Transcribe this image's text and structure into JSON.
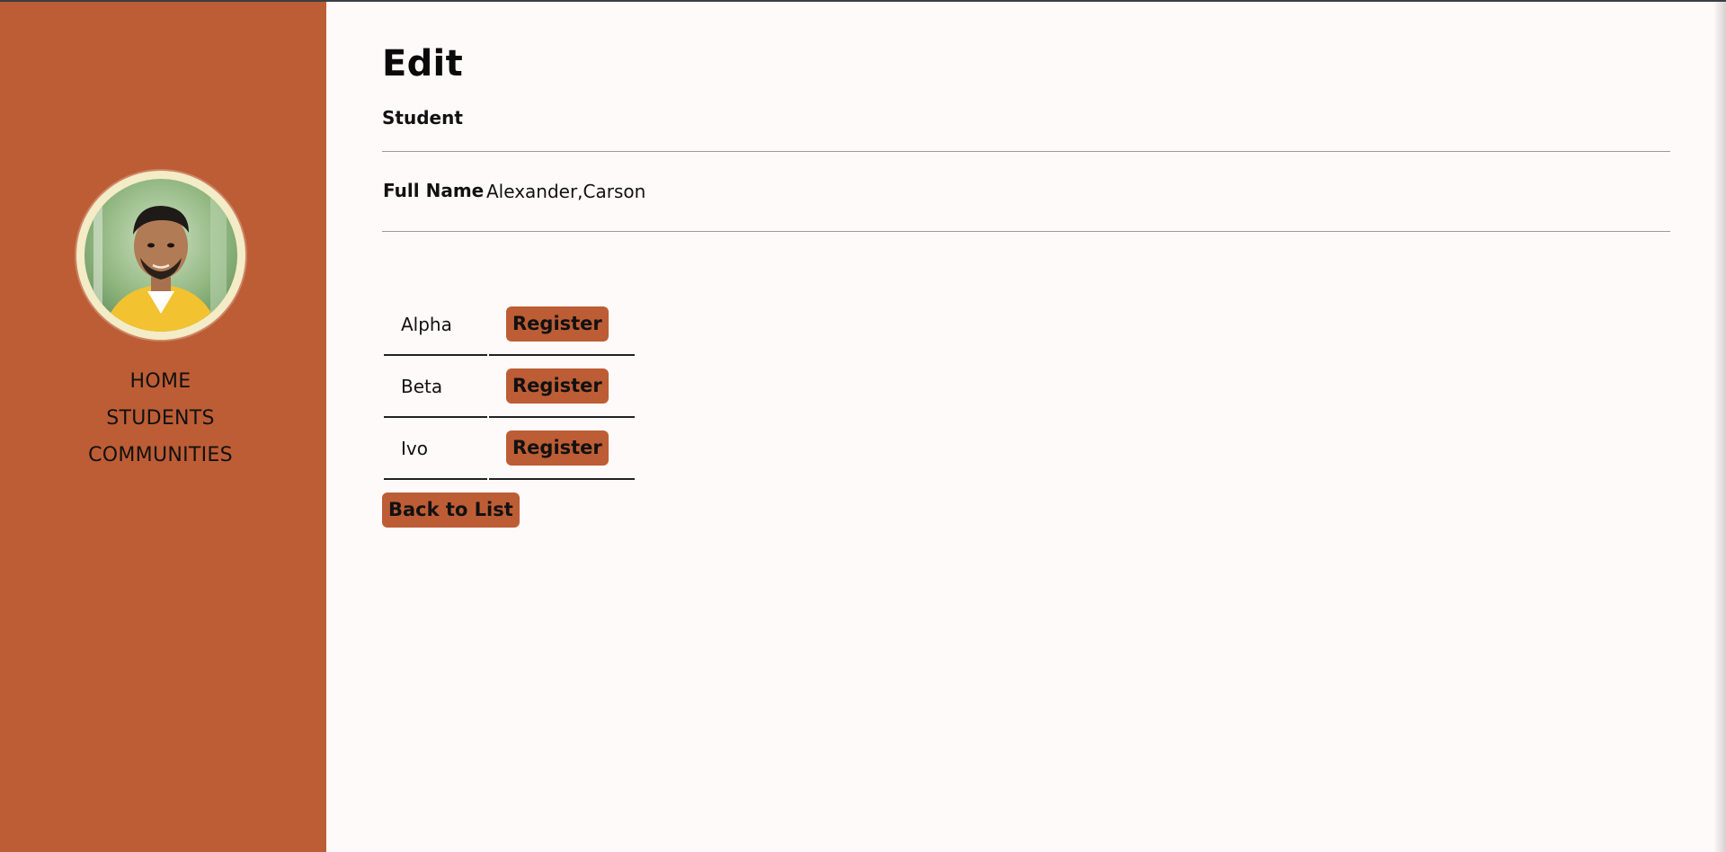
{
  "sidebar": {
    "nav": [
      {
        "label": "HOME"
      },
      {
        "label": "STUDENTS"
      },
      {
        "label": "COMMUNITIES"
      }
    ]
  },
  "page": {
    "title": "Edit",
    "subtitle": "Student"
  },
  "student": {
    "full_name_label": "Full Name",
    "full_name_value": "Alexander,Carson"
  },
  "communities": [
    {
      "name": "Alpha",
      "action": "Register"
    },
    {
      "name": "Beta",
      "action": "Register"
    },
    {
      "name": "Ivo",
      "action": "Register"
    }
  ],
  "actions": {
    "back_label": "Back to List"
  },
  "colors": {
    "accent": "#bd5d35",
    "background": "#fffafa"
  }
}
